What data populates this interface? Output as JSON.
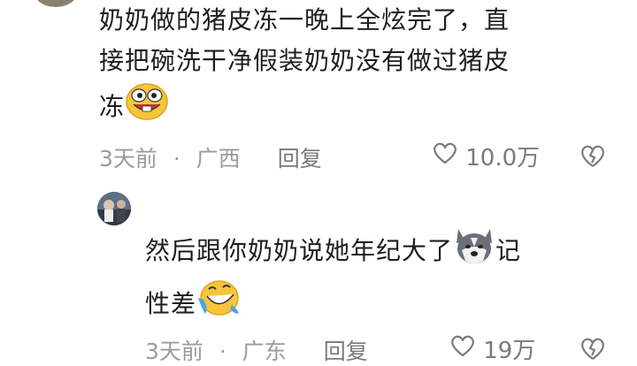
{
  "comment": {
    "line1": "奶奶做的猪皮冻一晚上全炫完了，直",
    "line2": "接把碗洗干净假装奶奶没有做过猪皮",
    "line3": "冻",
    "emoji_icon": "grinning-buck-teeth-emoji-icon",
    "time": "3天前",
    "separator": "·",
    "location": "广西",
    "reply_label": "回复",
    "like_count": "10.0万"
  },
  "reply": {
    "line1": "然后跟你奶奶说她年纪大了",
    "line1_emoji": "husky-dog-emoji-icon",
    "line1_end": "记",
    "line2": "性差",
    "line2_emoji": "rolling-laughing-emoji-icon",
    "time": "3天前",
    "separator": "·",
    "location": "广东",
    "reply_label": "回复",
    "like_count": "19万"
  },
  "colors": {
    "text": "#1e1e1e",
    "meta": "#9b9b9b",
    "icon": "#7a7a7a"
  }
}
